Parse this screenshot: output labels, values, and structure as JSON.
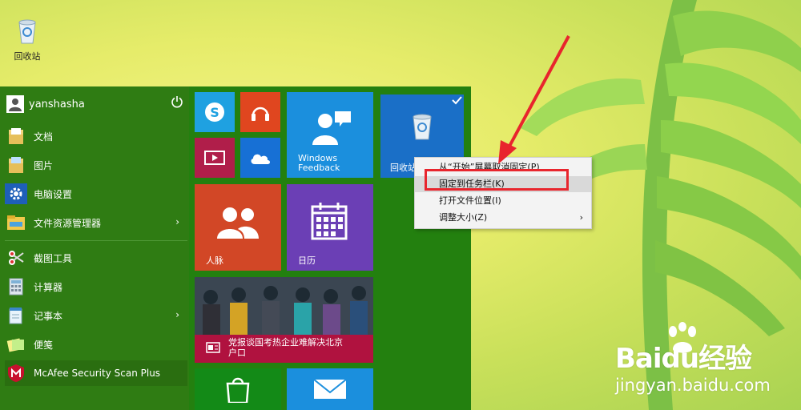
{
  "desktop": {
    "recycle_label": "回收站"
  },
  "user": {
    "name": "yanshasha"
  },
  "menu_items": [
    {
      "label": "文档",
      "icon": "folder-doc-icon"
    },
    {
      "label": "图片",
      "icon": "folder-pictures-icon"
    },
    {
      "label": "电脑设置",
      "icon": "gear-icon"
    },
    {
      "label": "文件资源管理器",
      "icon": "file-explorer-icon"
    },
    {
      "label": "截图工具",
      "icon": "scissors-icon"
    },
    {
      "label": "计算器",
      "icon": "calculator-icon"
    },
    {
      "label": "记事本",
      "icon": "notepad-icon"
    },
    {
      "label": "便笺",
      "icon": "sticky-note-icon"
    },
    {
      "label": "McAfee Security Scan Plus",
      "icon": "mcafee-icon"
    }
  ],
  "tiles": {
    "feedback": "Windows Feedback",
    "feedback_line1": "Windows",
    "feedback_line2": "Feedback",
    "recycle": "回收站",
    "people": "人脉",
    "calendar": "日历",
    "news": "党报谈国考热企业难解决北京户口"
  },
  "news_line1": "党报谈国考热企业难解决北京",
  "news_line2": "户口",
  "context_menu": [
    {
      "label": "从“开始”屏幕取消固定(P)"
    },
    {
      "label": "固定到任务栏(K)"
    },
    {
      "label": "打开文件位置(I)"
    },
    {
      "label": "调整大小(Z)"
    }
  ],
  "watermark": {
    "logo": "Baidu经验",
    "site": "jingyan.baidu.com"
  },
  "colors": {
    "start_bg": "#23800f",
    "tile_blue": "#1b8fdd",
    "tile_red": "#d24726",
    "tile_crimson": "#c2185b",
    "tile_purple": "#6b3fb5",
    "tile_green": "#138a17",
    "highlight": "#e8252d"
  }
}
